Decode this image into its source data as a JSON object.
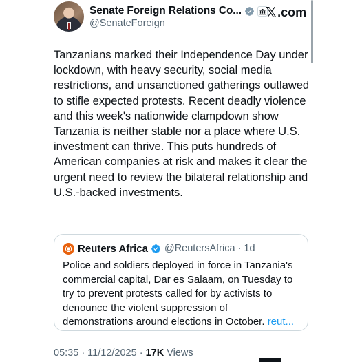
{
  "author": {
    "display_name": "Senate Foreign Relations Co...",
    "handle": "@SenateForeign",
    "verified_color": "#829aab"
  },
  "site_logo": {
    "x": "𝕏",
    "suffix": ".com"
  },
  "tweet": {
    "text": "Tanzanians marked their Independence Day under lockdown, with heavy security, social media restrictions, and unsanctioned gatherings outlawed to stifle expected protests. Recent deadly violence and this week's nationwide clampdown show Tanzania is neither stable nor a place where U.S. investment can thrive. This puts hundreds of American companies at risk and makes it clear the urgent need to review the bilateral relationship and U.S.-backed investments."
  },
  "quoted_tweet": {
    "name": "Reuters Africa",
    "handle_time": "@ReutersAfrica · 1d",
    "text": "Police and soldiers deployed in force in Tanzania's commercial capital, Dar es Salaam, on Tuesday to try to prevent protests called for by activists to denounce the violent suppression of demonstrations around elections in October.",
    "link_text": "reut...",
    "verified_color": "#1d9bf0"
  },
  "meta": {
    "time_date": "05:35 · 11/12/2025 · ",
    "views_count": "17K",
    "views_label": " Views"
  },
  "colors": {
    "text": "#0f1419",
    "secondary": "#536471",
    "link": "#1d9bf0",
    "border": "#cfd9de"
  }
}
